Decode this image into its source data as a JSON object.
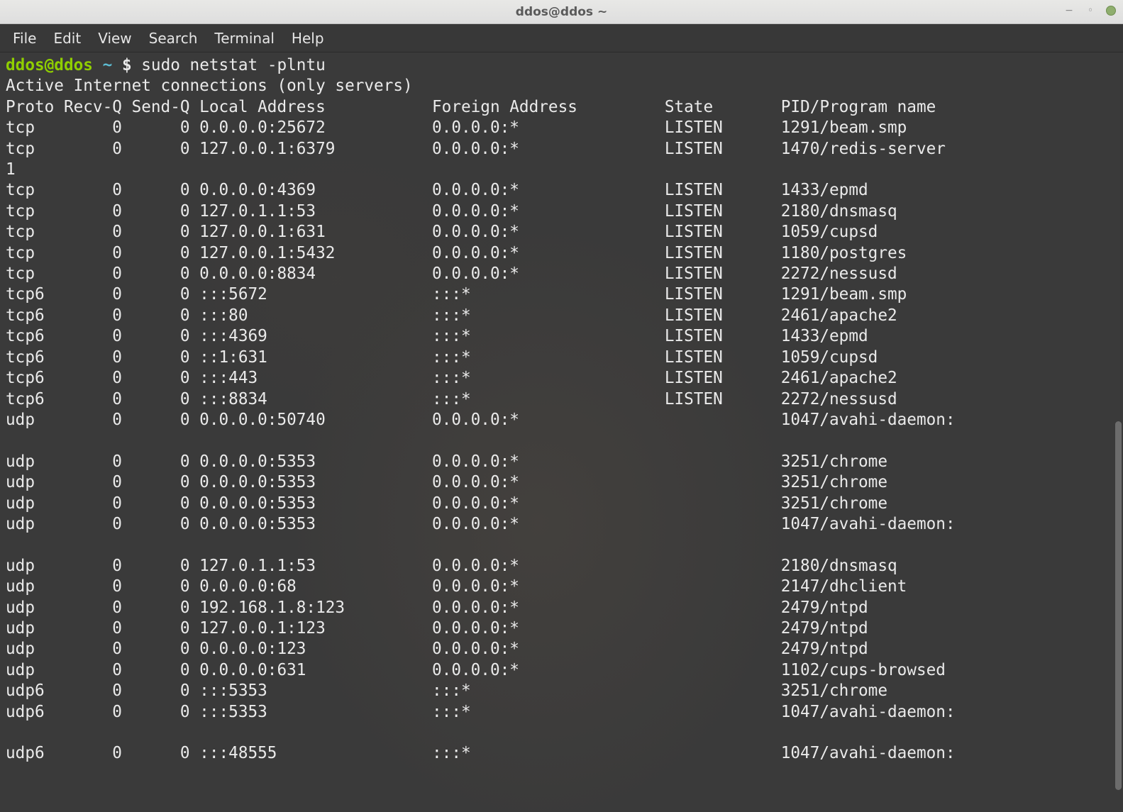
{
  "window": {
    "title": "ddos@ddos ~"
  },
  "menu": {
    "items": [
      "File",
      "Edit",
      "View",
      "Search",
      "Terminal",
      "Help"
    ]
  },
  "prompt": {
    "user_host": "ddos@ddos",
    "separator": " ",
    "path": "~",
    "symbol": " $",
    "command": "sudo netstat -plntu"
  },
  "output": {
    "header1": "Active Internet connections (only servers)",
    "columns": {
      "proto": "Proto",
      "recvq": "Recv-Q",
      "sendq": "Send-Q",
      "local": "Local Address",
      "foreign": "Foreign Address",
      "state": "State",
      "pid": "PID/Program name"
    },
    "rows": [
      {
        "proto": "tcp",
        "recvq": "0",
        "sendq": "0",
        "local": "0.0.0.0:25672",
        "foreign": "0.0.0.0:*",
        "state": "LISTEN",
        "pid": "1291/beam.smp",
        "wrap": ""
      },
      {
        "proto": "tcp",
        "recvq": "0",
        "sendq": "0",
        "local": "127.0.0.1:6379",
        "foreign": "0.0.0.0:*",
        "state": "LISTEN",
        "pid": "1470/redis-server",
        "wrap": "1"
      },
      {
        "proto": "tcp",
        "recvq": "0",
        "sendq": "0",
        "local": "0.0.0.0:4369",
        "foreign": "0.0.0.0:*",
        "state": "LISTEN",
        "pid": "1433/epmd",
        "wrap": ""
      },
      {
        "proto": "tcp",
        "recvq": "0",
        "sendq": "0",
        "local": "127.0.1.1:53",
        "foreign": "0.0.0.0:*",
        "state": "LISTEN",
        "pid": "2180/dnsmasq",
        "wrap": ""
      },
      {
        "proto": "tcp",
        "recvq": "0",
        "sendq": "0",
        "local": "127.0.0.1:631",
        "foreign": "0.0.0.0:*",
        "state": "LISTEN",
        "pid": "1059/cupsd",
        "wrap": ""
      },
      {
        "proto": "tcp",
        "recvq": "0",
        "sendq": "0",
        "local": "127.0.0.1:5432",
        "foreign": "0.0.0.0:*",
        "state": "LISTEN",
        "pid": "1180/postgres",
        "wrap": ""
      },
      {
        "proto": "tcp",
        "recvq": "0",
        "sendq": "0",
        "local": "0.0.0.0:8834",
        "foreign": "0.0.0.0:*",
        "state": "LISTEN",
        "pid": "2272/nessusd",
        "wrap": ""
      },
      {
        "proto": "tcp6",
        "recvq": "0",
        "sendq": "0",
        "local": ":::5672",
        "foreign": ":::*",
        "state": "LISTEN",
        "pid": "1291/beam.smp",
        "wrap": ""
      },
      {
        "proto": "tcp6",
        "recvq": "0",
        "sendq": "0",
        "local": ":::80",
        "foreign": ":::*",
        "state": "LISTEN",
        "pid": "2461/apache2",
        "wrap": ""
      },
      {
        "proto": "tcp6",
        "recvq": "0",
        "sendq": "0",
        "local": ":::4369",
        "foreign": ":::*",
        "state": "LISTEN",
        "pid": "1433/epmd",
        "wrap": ""
      },
      {
        "proto": "tcp6",
        "recvq": "0",
        "sendq": "0",
        "local": "::1:631",
        "foreign": ":::*",
        "state": "LISTEN",
        "pid": "1059/cupsd",
        "wrap": ""
      },
      {
        "proto": "tcp6",
        "recvq": "0",
        "sendq": "0",
        "local": ":::443",
        "foreign": ":::*",
        "state": "LISTEN",
        "pid": "2461/apache2",
        "wrap": ""
      },
      {
        "proto": "tcp6",
        "recvq": "0",
        "sendq": "0",
        "local": ":::8834",
        "foreign": ":::*",
        "state": "LISTEN",
        "pid": "2272/nessusd",
        "wrap": ""
      },
      {
        "proto": "udp",
        "recvq": "0",
        "sendq": "0",
        "local": "0.0.0.0:50740",
        "foreign": "0.0.0.0:*",
        "state": "",
        "pid": "1047/avahi-daemon:",
        "wrap": " "
      },
      {
        "proto": "udp",
        "recvq": "0",
        "sendq": "0",
        "local": "0.0.0.0:5353",
        "foreign": "0.0.0.0:*",
        "state": "",
        "pid": "3251/chrome",
        "wrap": ""
      },
      {
        "proto": "udp",
        "recvq": "0",
        "sendq": "0",
        "local": "0.0.0.0:5353",
        "foreign": "0.0.0.0:*",
        "state": "",
        "pid": "3251/chrome",
        "wrap": ""
      },
      {
        "proto": "udp",
        "recvq": "0",
        "sendq": "0",
        "local": "0.0.0.0:5353",
        "foreign": "0.0.0.0:*",
        "state": "",
        "pid": "3251/chrome",
        "wrap": ""
      },
      {
        "proto": "udp",
        "recvq": "0",
        "sendq": "0",
        "local": "0.0.0.0:5353",
        "foreign": "0.0.0.0:*",
        "state": "",
        "pid": "1047/avahi-daemon:",
        "wrap": " "
      },
      {
        "proto": "udp",
        "recvq": "0",
        "sendq": "0",
        "local": "127.0.1.1:53",
        "foreign": "0.0.0.0:*",
        "state": "",
        "pid": "2180/dnsmasq",
        "wrap": ""
      },
      {
        "proto": "udp",
        "recvq": "0",
        "sendq": "0",
        "local": "0.0.0.0:68",
        "foreign": "0.0.0.0:*",
        "state": "",
        "pid": "2147/dhclient",
        "wrap": ""
      },
      {
        "proto": "udp",
        "recvq": "0",
        "sendq": "0",
        "local": "192.168.1.8:123",
        "foreign": "0.0.0.0:*",
        "state": "",
        "pid": "2479/ntpd",
        "wrap": ""
      },
      {
        "proto": "udp",
        "recvq": "0",
        "sendq": "0",
        "local": "127.0.0.1:123",
        "foreign": "0.0.0.0:*",
        "state": "",
        "pid": "2479/ntpd",
        "wrap": ""
      },
      {
        "proto": "udp",
        "recvq": "0",
        "sendq": "0",
        "local": "0.0.0.0:123",
        "foreign": "0.0.0.0:*",
        "state": "",
        "pid": "2479/ntpd",
        "wrap": ""
      },
      {
        "proto": "udp",
        "recvq": "0",
        "sendq": "0",
        "local": "0.0.0.0:631",
        "foreign": "0.0.0.0:*",
        "state": "",
        "pid": "1102/cups-browsed",
        "wrap": ""
      },
      {
        "proto": "udp6",
        "recvq": "0",
        "sendq": "0",
        "local": ":::5353",
        "foreign": ":::*",
        "state": "",
        "pid": "3251/chrome",
        "wrap": ""
      },
      {
        "proto": "udp6",
        "recvq": "0",
        "sendq": "0",
        "local": ":::5353",
        "foreign": ":::*",
        "state": "",
        "pid": "1047/avahi-daemon:",
        "wrap": " "
      },
      {
        "proto": "udp6",
        "recvq": "0",
        "sendq": "0",
        "local": ":::48555",
        "foreign": ":::*",
        "state": "",
        "pid": "1047/avahi-daemon:",
        "wrap": " "
      }
    ],
    "col_widths": {
      "proto": 6,
      "recvq": 7,
      "sendq": 7,
      "local": 24,
      "foreign": 24,
      "state": 12
    }
  }
}
